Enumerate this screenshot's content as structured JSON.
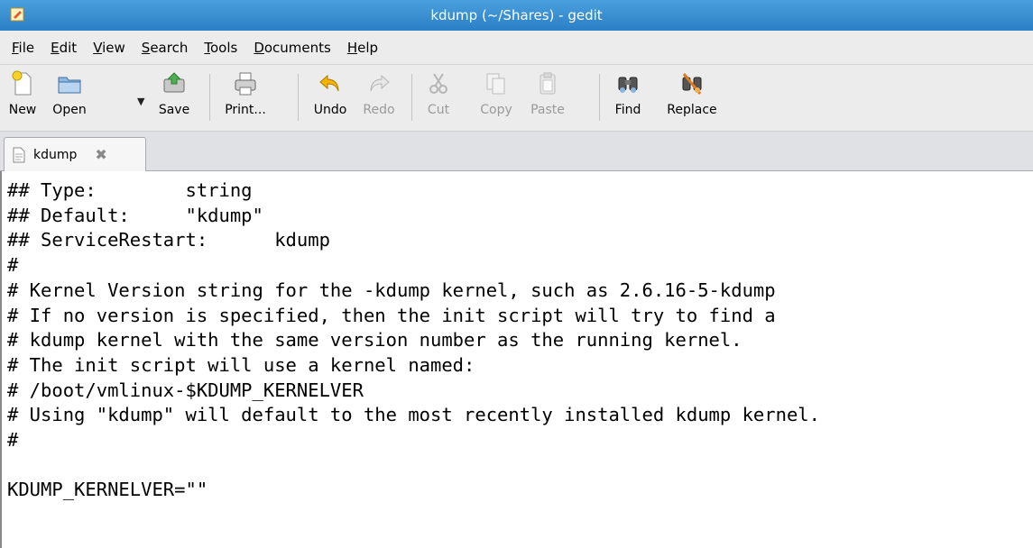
{
  "window": {
    "title": "kdump (~/Shares) - gedit"
  },
  "menu": [
    {
      "mnemonic": "F",
      "rest": "ile"
    },
    {
      "mnemonic": "E",
      "rest": "dit"
    },
    {
      "mnemonic": "V",
      "rest": "iew"
    },
    {
      "mnemonic": "S",
      "rest": "earch"
    },
    {
      "mnemonic": "T",
      "rest": "ools"
    },
    {
      "mnemonic": "D",
      "rest": "ocuments"
    },
    {
      "mnemonic": "H",
      "rest": "elp"
    }
  ],
  "toolbar": {
    "new": "New",
    "open": "Open",
    "save": "Save",
    "print": "Print...",
    "undo": "Undo",
    "redo": "Redo",
    "cut": "Cut",
    "copy": "Copy",
    "paste": "Paste",
    "find": "Find",
    "replace": "Replace"
  },
  "tab": {
    "label": "kdump"
  },
  "editor": {
    "lines": [
      "## Type:        string",
      "## Default:     \"kdump\"",
      "## ServiceRestart:      kdump",
      "#",
      "# Kernel Version string for the -kdump kernel, such as 2.6.16-5-kdump",
      "# If no version is specified, then the init script will try to find a",
      "# kdump kernel with the same version number as the running kernel.",
      "# The init script will use a kernel named:",
      "# /boot/vmlinux-$KDUMP_KERNELVER",
      "# Using \"kdump\" will default to the most recently installed kdump kernel.",
      "#",
      "",
      "KDUMP_KERNELVER=\"\""
    ]
  }
}
